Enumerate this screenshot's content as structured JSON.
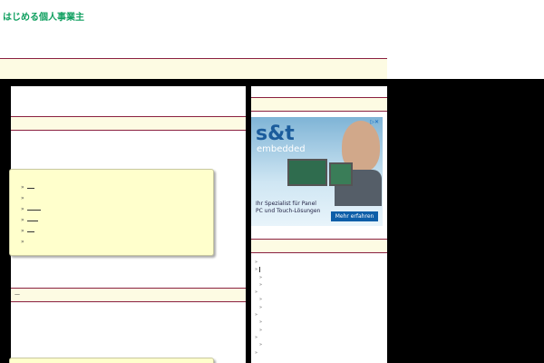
{
  "site": {
    "title": "はじめる個人事業主"
  },
  "main": {
    "section1_title": "",
    "box1_items": [
      {
        "label": ""
      },
      {
        "label": ""
      },
      {
        "label": ""
      },
      {
        "label": ""
      },
      {
        "label": ""
      },
      {
        "label": ""
      }
    ],
    "section2_title": "—"
  },
  "sidebar": {
    "ad": {
      "logo": "s&t",
      "sub": "embedded",
      "tagline": "Ihr Spezialist für Panel PC und Touch-Lösungen",
      "button": "Mehr erfahren"
    },
    "list_items": [
      "",
      "",
      "",
      "",
      "",
      "",
      "",
      "",
      "",
      "",
      "",
      "",
      ""
    ]
  },
  "icons": {
    "bullet": "»",
    "ad_choices": "ad-choices-icon"
  }
}
